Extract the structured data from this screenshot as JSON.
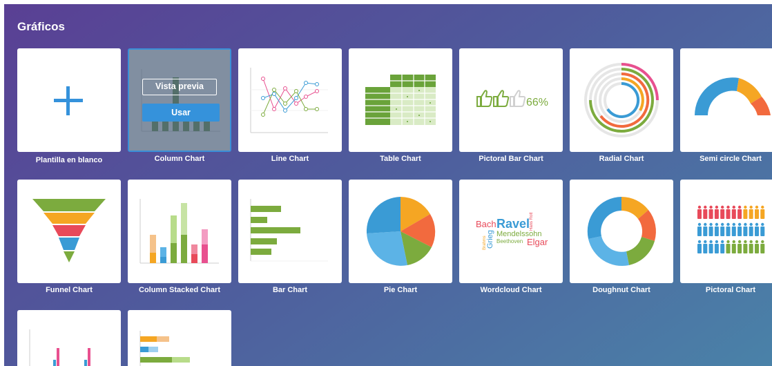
{
  "header": {
    "title": "Gráficos"
  },
  "blank_template": {
    "label": "Plantilla en blanco",
    "icon": "plus-icon"
  },
  "hover_actions": {
    "preview_label": "Vista previa",
    "use_label": "Usar"
  },
  "charts": [
    {
      "label": "Column Chart"
    },
    {
      "label": "Line Chart"
    },
    {
      "label": "Table Chart"
    },
    {
      "label": "Pictoral Bar Chart",
      "value_text": "66%"
    },
    {
      "label": "Radial Chart"
    },
    {
      "label": "Semi circle Chart"
    },
    {
      "label": "Funnel Chart"
    },
    {
      "label": "Column Stacked Chart"
    },
    {
      "label": "Bar Chart"
    },
    {
      "label": "Pie Chart"
    },
    {
      "label": "Wordcloud Chart",
      "words": [
        "Bach",
        "Ravel",
        "Hans Rott",
        "Mendelssohn",
        "Brahms",
        "Grieg",
        "Beethoven",
        "Elgar"
      ]
    },
    {
      "label": "Doughnut Chart"
    },
    {
      "label": "Pictoral Chart"
    }
  ],
  "colors": {
    "accent": "#3592db",
    "green": "#7cab3e",
    "orange": "#f5a623",
    "red": "#f26a3e",
    "pink": "#e8508f",
    "blue": "#3a9bd5",
    "light_blue": "#5cb3e6"
  }
}
